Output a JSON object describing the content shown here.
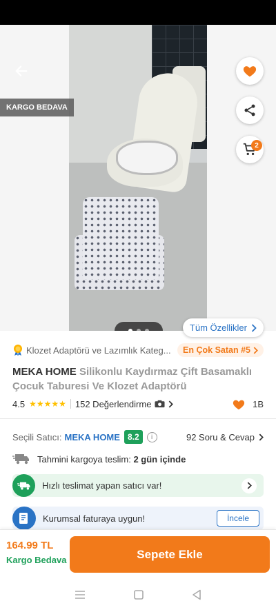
{
  "gallery": {
    "cargo_badge": "KARGO BEDAVA",
    "cart_count": "2",
    "all_features": "Tüm Özellikler"
  },
  "product": {
    "category": "Klozet Adaptörü ve Lazımlık Kateg...",
    "best_seller": "En Çok Satan #5",
    "brand": "MEKA HOME",
    "name": "Silikonlu Kaydırmaz Çift Basamaklı Çocuk Taburesi Ve Klozet Adaptörü",
    "rating": "4.5",
    "review_count": "152 Değerlendirme",
    "like_count": "1B"
  },
  "seller": {
    "label": "Seçili Satıcı:",
    "name": "MEKA HOME",
    "score": "8.2",
    "qa": "92 Soru & Cevap"
  },
  "delivery": {
    "label": "Tahmini kargoya teslim:",
    "value": "2 gün içinde"
  },
  "fast_delivery": {
    "text": "Hızlı teslimat yapan satıcı var!"
  },
  "invoice": {
    "text": "Kurumsal faturaya uygun!",
    "button": "İncele"
  },
  "footer": {
    "price": "164.99 TL",
    "free_cargo": "Kargo Bedava",
    "add_to_cart": "Sepete Ekle"
  },
  "colors": {
    "accent": "#f27a1a",
    "green": "#1ea05a",
    "link": "#2a73c5"
  }
}
